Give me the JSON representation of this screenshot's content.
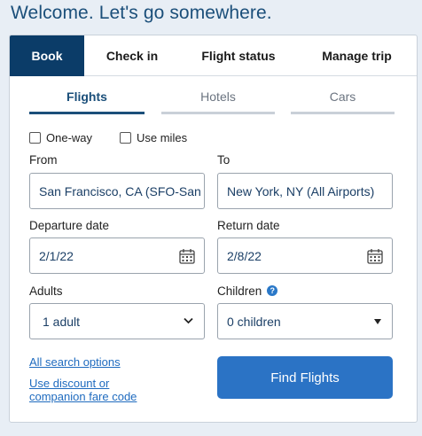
{
  "header": {
    "title": "Welcome. Let's go somewhere."
  },
  "top_tabs": [
    {
      "label": "Book",
      "active": true
    },
    {
      "label": "Check in",
      "active": false
    },
    {
      "label": "Flight status",
      "active": false
    },
    {
      "label": "Manage trip",
      "active": false
    }
  ],
  "sub_tabs": [
    {
      "label": "Flights",
      "active": true
    },
    {
      "label": "Hotels",
      "active": false
    },
    {
      "label": "Cars",
      "active": false
    }
  ],
  "options": {
    "one_way_label": "One-way",
    "one_way_checked": false,
    "use_miles_label": "Use miles",
    "use_miles_checked": false
  },
  "from": {
    "label": "From",
    "value": "San Francisco, CA (SFO-San Francisco Intl.)"
  },
  "to": {
    "label": "To",
    "value": "New York, NY (All Airports)"
  },
  "departure": {
    "label": "Departure date",
    "value": "2/1/22",
    "icon": "calendar-icon"
  },
  "return": {
    "label": "Return date",
    "value": "2/8/22",
    "icon": "calendar-icon"
  },
  "adults": {
    "label": "Adults",
    "value": "1 adult",
    "icon": "chevron-down-icon"
  },
  "children": {
    "label": "Children",
    "value": "0 children",
    "help_icon": "?"
  },
  "links": {
    "all_search_options": "All search options",
    "discount_line1": "Use discount or",
    "discount_line2": "companion fare code"
  },
  "find_button": {
    "label": "Find Flights"
  },
  "colors": {
    "brand_dark": "#0b3c68",
    "accent": "#2b73c5",
    "link": "#1f6bbf",
    "background": "#e8eef5"
  }
}
